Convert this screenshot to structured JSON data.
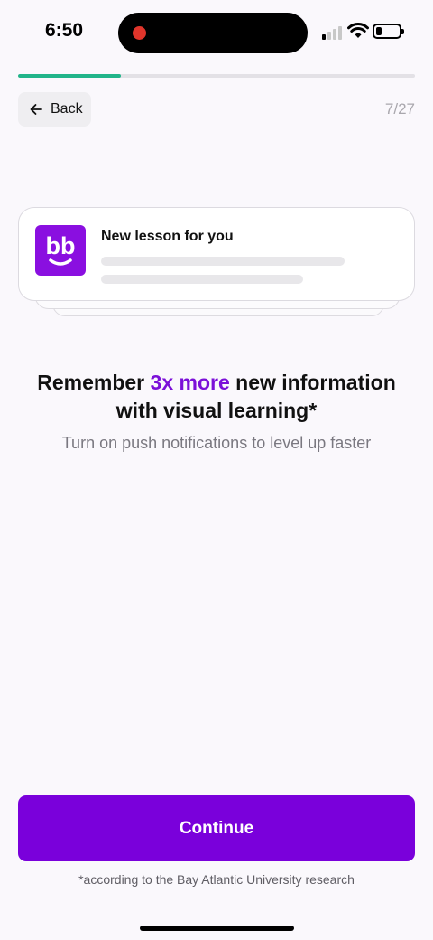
{
  "status_bar": {
    "time": "6:50",
    "battery_level": 0.35,
    "signal_bars_active": 1,
    "recording_color": "#e0352b"
  },
  "progress": {
    "fraction": 0.26,
    "color": "#21b58a"
  },
  "header": {
    "back_label": "Back",
    "step_counter": "7/27"
  },
  "notification": {
    "title": "New lesson for you",
    "app_icon": "bb-logo-icon",
    "brand_color": "#8a0fe0"
  },
  "headline": {
    "part1": "Remember ",
    "accent": "3x more",
    "part2": " new information with visual learning*",
    "accent_color": "#7b10d8"
  },
  "subtext": "Turn on push notifications to level up faster",
  "cta": {
    "label": "Continue",
    "color": "#7a00db"
  },
  "footnote": "*according to the Bay Atlantic University research"
}
